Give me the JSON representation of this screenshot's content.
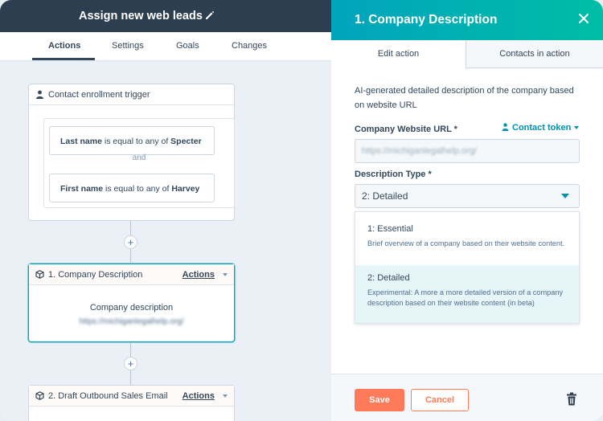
{
  "workflow": {
    "title": "Assign new web leads",
    "tabs": [
      {
        "label": "Actions",
        "active": true
      },
      {
        "label": "Settings",
        "active": false
      },
      {
        "label": "Goals",
        "active": false
      },
      {
        "label": "Changes",
        "active": false
      }
    ]
  },
  "trigger": {
    "title": "Contact enrollment trigger",
    "filters": [
      {
        "property": "Last name",
        "operator": "is equal to any of",
        "value": "Specter"
      },
      {
        "property": "First name",
        "operator": "is equal to any of",
        "value": "Harvey"
      }
    ],
    "joiner": "and"
  },
  "steps": [
    {
      "title": "1. Company Description",
      "actions_label": "Actions",
      "body_label": "Company description",
      "body_value": "https://michiganlegalhelp.org/"
    },
    {
      "title": "2. Draft Outbound Sales Email",
      "actions_label": "Actions"
    }
  ],
  "add_symbol": "+",
  "panel": {
    "title": "1. Company Description",
    "tabs": {
      "edit": "Edit action",
      "contacts": "Contacts in action"
    },
    "description": "AI-generated detailed description of the company based on website URL",
    "url_field": {
      "label": "Company Website URL *",
      "token_label": "Contact token",
      "value": "https://michiganlegalhelp.org/"
    },
    "type_field": {
      "label": "Description Type *",
      "selected": "2: Detailed"
    },
    "options": [
      {
        "title": "1: Essential",
        "description": "Brief overview of a company based on their website content.",
        "selected": false
      },
      {
        "title": "2: Detailed",
        "description": "Experimental: A more a more detailed version of a company description based on their website content (in beta)",
        "selected": true
      }
    ],
    "save_label": "Save",
    "cancel_label": "Cancel"
  },
  "colors": {
    "accent": "#00a4bd",
    "header_dark": "#2d3e50",
    "primary_button": "#ff7a59",
    "link": "#0091ae"
  },
  "icons": [
    "pencil-icon",
    "person-icon",
    "cube-icon",
    "close-icon",
    "trash-icon",
    "chevron-down-icon"
  ]
}
